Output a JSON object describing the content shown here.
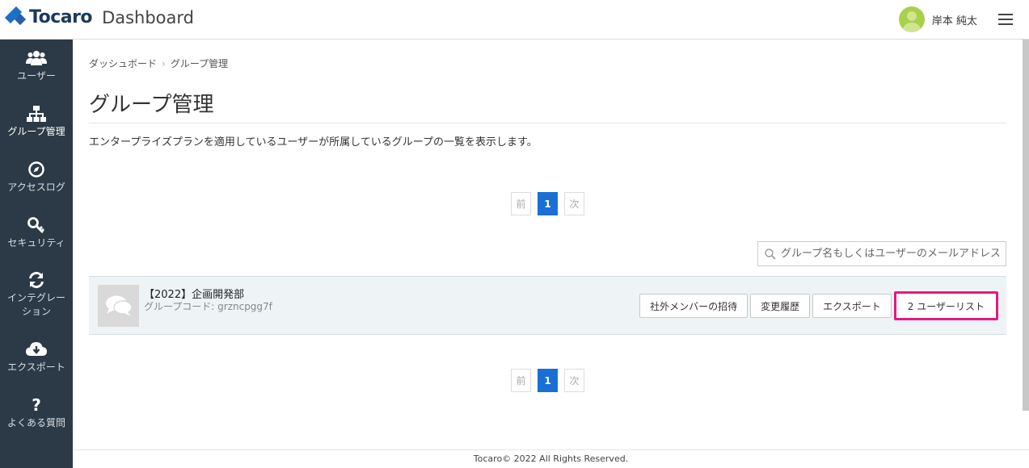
{
  "header": {
    "brand": "Tocaro",
    "subtitle": "Dashboard",
    "user_name": "岸本 純太"
  },
  "sidebar": {
    "items": [
      {
        "label": "ユーザー",
        "icon": "users-icon"
      },
      {
        "label": "グループ管理",
        "icon": "sitemap-icon",
        "active": true
      },
      {
        "label": "アクセスログ",
        "icon": "compass-icon"
      },
      {
        "label": "セキュリティ",
        "icon": "key-icon"
      },
      {
        "label": "インテグレー\nション",
        "icon": "sync-icon"
      },
      {
        "label": "エクスポート",
        "icon": "cloud-download-icon"
      },
      {
        "label": "よくある質問",
        "icon": "question-icon"
      }
    ]
  },
  "breadcrumb": {
    "home": "ダッシュボード",
    "current": "グループ管理"
  },
  "page": {
    "title": "グループ管理",
    "description": "エンタープライズプランを適用しているユーザーが所属しているグループの一覧を表示します。"
  },
  "pagination": {
    "prev": "前",
    "current": "1",
    "next": "次"
  },
  "search": {
    "placeholder": "グループ名もしくはユーザーのメールアドレス"
  },
  "groups": [
    {
      "name": "【2022】企画開発部",
      "code": "グループコード: grzncpgg7f",
      "actions": {
        "invite": "社外メンバーの招待",
        "history": "変更履歴",
        "export": "エクスポート",
        "user_list": "2 ユーザーリスト"
      }
    }
  ],
  "footer": {
    "copyright": "Tocaro© 2022 All Rights Reserved."
  },
  "colors": {
    "sidebar_bg": "#2c3a47",
    "accent": "#1a6fd6",
    "highlight": "#e6197e",
    "logo": "#1a70c7"
  }
}
